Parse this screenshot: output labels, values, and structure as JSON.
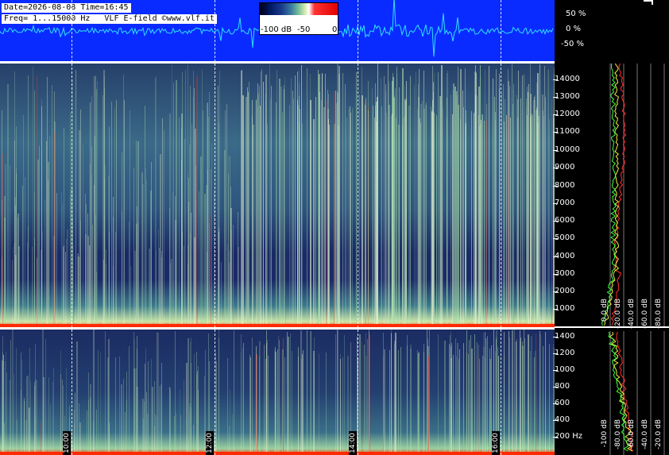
{
  "header": {
    "line1": "Date=2026-08-08 Time=16:45",
    "line2": "Freq= 1...15000 Hz   VLF E-field ©www.vlf.it"
  },
  "colorbar": {
    "labels": [
      "-100 dB",
      "-50",
      "0"
    ]
  },
  "waveform": {
    "percent_labels": [
      "50 %",
      "0 %",
      "-50 %"
    ]
  },
  "upper_panel": {
    "freq_ticks": [
      "14000",
      "13000",
      "12000",
      "11000",
      "10000",
      "9000",
      "8000",
      "7000",
      "6000",
      "5000",
      "4000",
      "3000",
      "2000",
      "1000"
    ],
    "db_labels": [
      "0.0 dB",
      "-20.0 dB",
      "-40.0 dB",
      "-60.0 dB",
      "-80.0 dB"
    ]
  },
  "lower_panel": {
    "freq_ticks": [
      "1400",
      "1200",
      "1000",
      "800",
      "600",
      "400",
      "200 Hz"
    ],
    "db_labels": [
      "0.0 dB",
      "-20.0 dB",
      "-40.0 dB",
      "-60.0 dB",
      "-80.0 dB",
      "-100 dB"
    ]
  },
  "time_labels": [
    "10:00",
    "12:00",
    "14:00",
    "16:00"
  ],
  "colors": {
    "band_blue": "#0a2bff",
    "waveform": "#2fe0ff",
    "red_line": "#ff2a00"
  }
}
